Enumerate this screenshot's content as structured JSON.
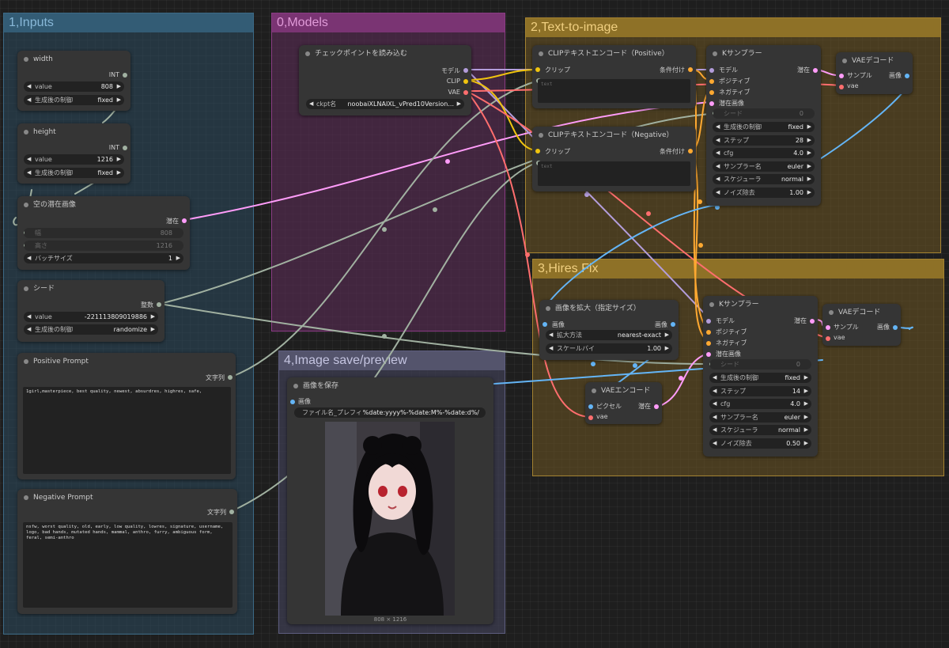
{
  "colors": {
    "inputs_group": "#2b4a5e",
    "models_group": "#5a2b55",
    "t2i_group": "#6d5623",
    "hires_group": "#6d5623",
    "save_group": "#3d3d52",
    "link_model": "#b39ddb",
    "link_clip": "#f0c40f",
    "link_vae": "#ff6e6e",
    "link_cond": "#ffa931",
    "link_latent": "#ff9cf9",
    "link_image": "#64b5f6",
    "link_int": "#a1b1a1"
  },
  "groups": {
    "inputs": "1,Inputs",
    "models": "0,Models",
    "t2i": "2,Text-to-image",
    "hires": "3,Hires Fix",
    "save": "4,Image save/preview"
  },
  "width_node": {
    "title": "width",
    "out": "INT",
    "value_label": "value",
    "value": "808",
    "control_label": "生成後の制御",
    "control": "fixed"
  },
  "height_node": {
    "title": "height",
    "out": "INT",
    "value_label": "value",
    "value": "1216",
    "control_label": "生成後の制御",
    "control": "fixed"
  },
  "latent_node": {
    "title": "空の潜在画像",
    "out": "潜在",
    "width_label": "幅",
    "width": "808",
    "height_label": "高さ",
    "height": "1216",
    "batch_label": "バッチサイズ",
    "batch": "1"
  },
  "seed_node": {
    "title": "シード",
    "out": "整数",
    "value_label": "value",
    "value": "-221113809019886",
    "control_label": "生成後の制御",
    "control": "randomize"
  },
  "positive_prompt": {
    "title": "Positive Prompt",
    "out": "文字列",
    "text": "1girl,masterpiece, best quality, newest, absurdres, highres, safe,"
  },
  "negative_prompt": {
    "title": "Negative Prompt",
    "out": "文字列",
    "text": "nsfw, worst quality, old, early, low quality, lowres, signature, username, logo, bad hands, mutated hands, mammal, anthro, furry, ambiguous form, feral, semi-anthro"
  },
  "checkpoint_node": {
    "title": "チェックポイントを読み込む",
    "out_model": "モデル",
    "out_clip": "CLIP",
    "out_vae": "VAE",
    "ckpt_label": "ckpt名",
    "ckpt": "noobaiXLNAIXL_vPred10Version..."
  },
  "clip_pos": {
    "title": "CLIPテキストエンコード（Positive）",
    "in_clip": "クリップ",
    "out": "条件付け",
    "placeholder": "text"
  },
  "clip_neg": {
    "title": "CLIPテキストエンコード（Negative）",
    "in_clip": "クリップ",
    "out": "条件付け",
    "placeholder": "text"
  },
  "ksampler1": {
    "title": "Kサンプラー",
    "in_model": "モデル",
    "in_pos": "ポジティブ",
    "in_neg": "ネガティブ",
    "in_latent": "潜在画像",
    "out": "潜在",
    "seed_label": "シード",
    "seed": "0",
    "control_label": "生成後の制御",
    "control": "fixed",
    "steps_label": "ステップ",
    "steps": "28",
    "cfg_label": "cfg",
    "cfg": "4.0",
    "sampler_label": "サンプラー名",
    "sampler": "euler",
    "scheduler_label": "スケジューラ",
    "scheduler": "normal",
    "denoise_label": "ノイズ除去",
    "denoise": "1.00"
  },
  "vae_decode1": {
    "title": "VAEデコード",
    "in_samples": "サンプル",
    "in_vae": "vae",
    "out": "画像"
  },
  "upscale_node": {
    "title": "画像を拡大（指定サイズ）",
    "in": "画像",
    "out": "画像",
    "method_label": "拡大方法",
    "method": "nearest-exact",
    "scale_label": "スケールバイ",
    "scale": "1.00"
  },
  "ksampler2": {
    "title": "Kサンプラー",
    "in_model": "モデル",
    "in_pos": "ポジティブ",
    "in_neg": "ネガティブ",
    "in_latent": "潜在画像",
    "out": "潜在",
    "seed_label": "シード",
    "seed": "0",
    "control_label": "生成後の制御",
    "control": "fixed",
    "steps_label": "ステップ",
    "steps": "14",
    "cfg_label": "cfg",
    "cfg": "4.0",
    "sampler_label": "サンプラー名",
    "sampler": "euler",
    "scheduler_label": "スケジューラ",
    "scheduler": "normal",
    "denoise_label": "ノイズ除去",
    "denoise": "0.50"
  },
  "vae_decode2": {
    "title": "VAEデコード",
    "in_samples": "サンプル",
    "in_vae": "vae",
    "out": "画像"
  },
  "vae_encode": {
    "title": "VAEエンコード",
    "in_pixels": "ピクセル",
    "in_vae": "vae",
    "out": "潜在"
  },
  "save_node": {
    "title": "画像を保存",
    "in": "画像",
    "prefix_label": "ファイル名_プレフィックス",
    "prefix": "%date:yyyy%-%date:M%-%date:d%/",
    "size": "808 × 1216"
  }
}
